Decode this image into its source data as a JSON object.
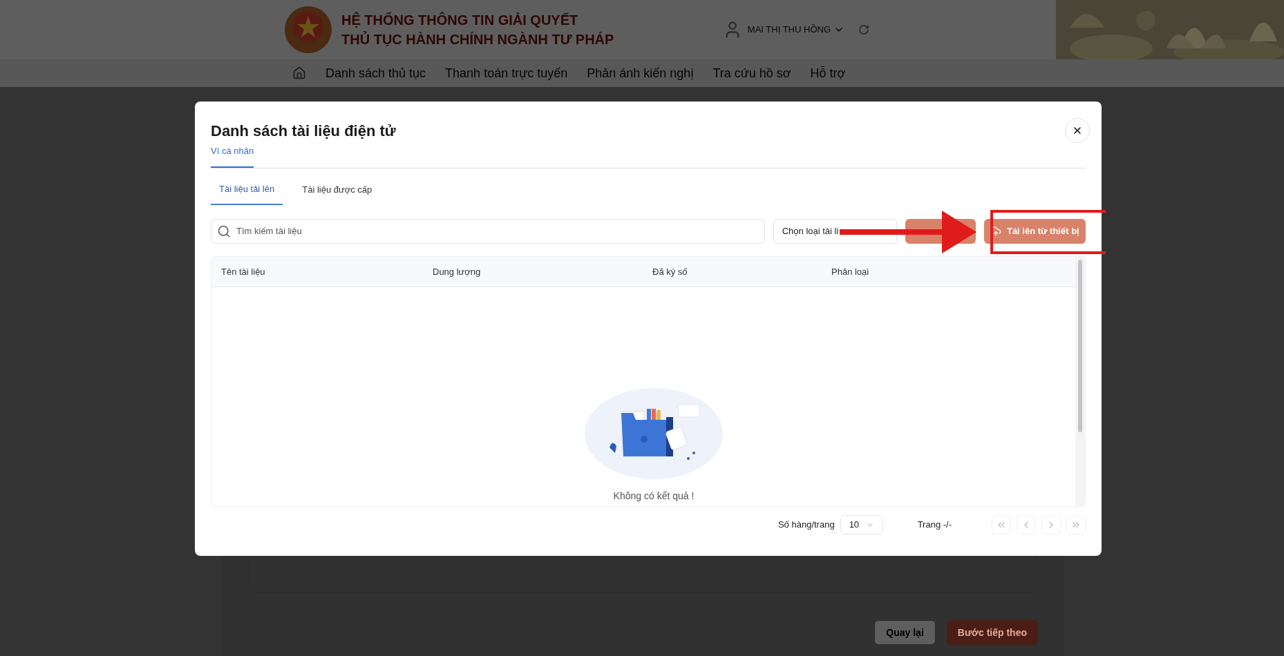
{
  "header": {
    "title_lines": [
      "HỆ THỐNG THÔNG TIN GIẢI QUYẾT",
      "THỦ TỤC HÀNH CHÍNH NGÀNH TƯ PHÁP"
    ],
    "user_name": "MAI THỊ THU HỒNG"
  },
  "nav": {
    "items": [
      "Danh sách thủ tục",
      "Thanh toán trực tuyến",
      "Phản ánh kiến nghị",
      "Tra cứu hồ sơ",
      "Hỗ trợ"
    ]
  },
  "form": {
    "buttons": [
      {
        "label": "Quay lại",
        "kind": "secondary"
      },
      {
        "label": "Bước tiếp theo",
        "kind": "primary"
      }
    ]
  },
  "dialog": {
    "title": "Danh sách tài liệu điện tử",
    "tabs": [
      {
        "label": "Ví cá nhân",
        "selected": true
      }
    ],
    "subtabs": [
      {
        "label": "Tài liệu tải lên",
        "selected": true
      },
      {
        "label": "Tài liệu được cấp",
        "selected": false
      }
    ],
    "search": {
      "placeholder": "Tìm kiếm tài liệu"
    },
    "type_select": {
      "value": "Chọn loại tài li"
    },
    "upload_button": {
      "label": "Tải lên từ thiết bị",
      "highlighted": true
    },
    "table": {
      "columns": [
        "Tên tài liệu",
        "Dung lượng",
        "Đã ký số",
        "Phân loại"
      ],
      "empty_text": "Không có kết quả !"
    },
    "pagination": {
      "rows_label": "Số hàng/trang",
      "rows_value": "10",
      "page_label": "Trang -/-"
    }
  }
}
